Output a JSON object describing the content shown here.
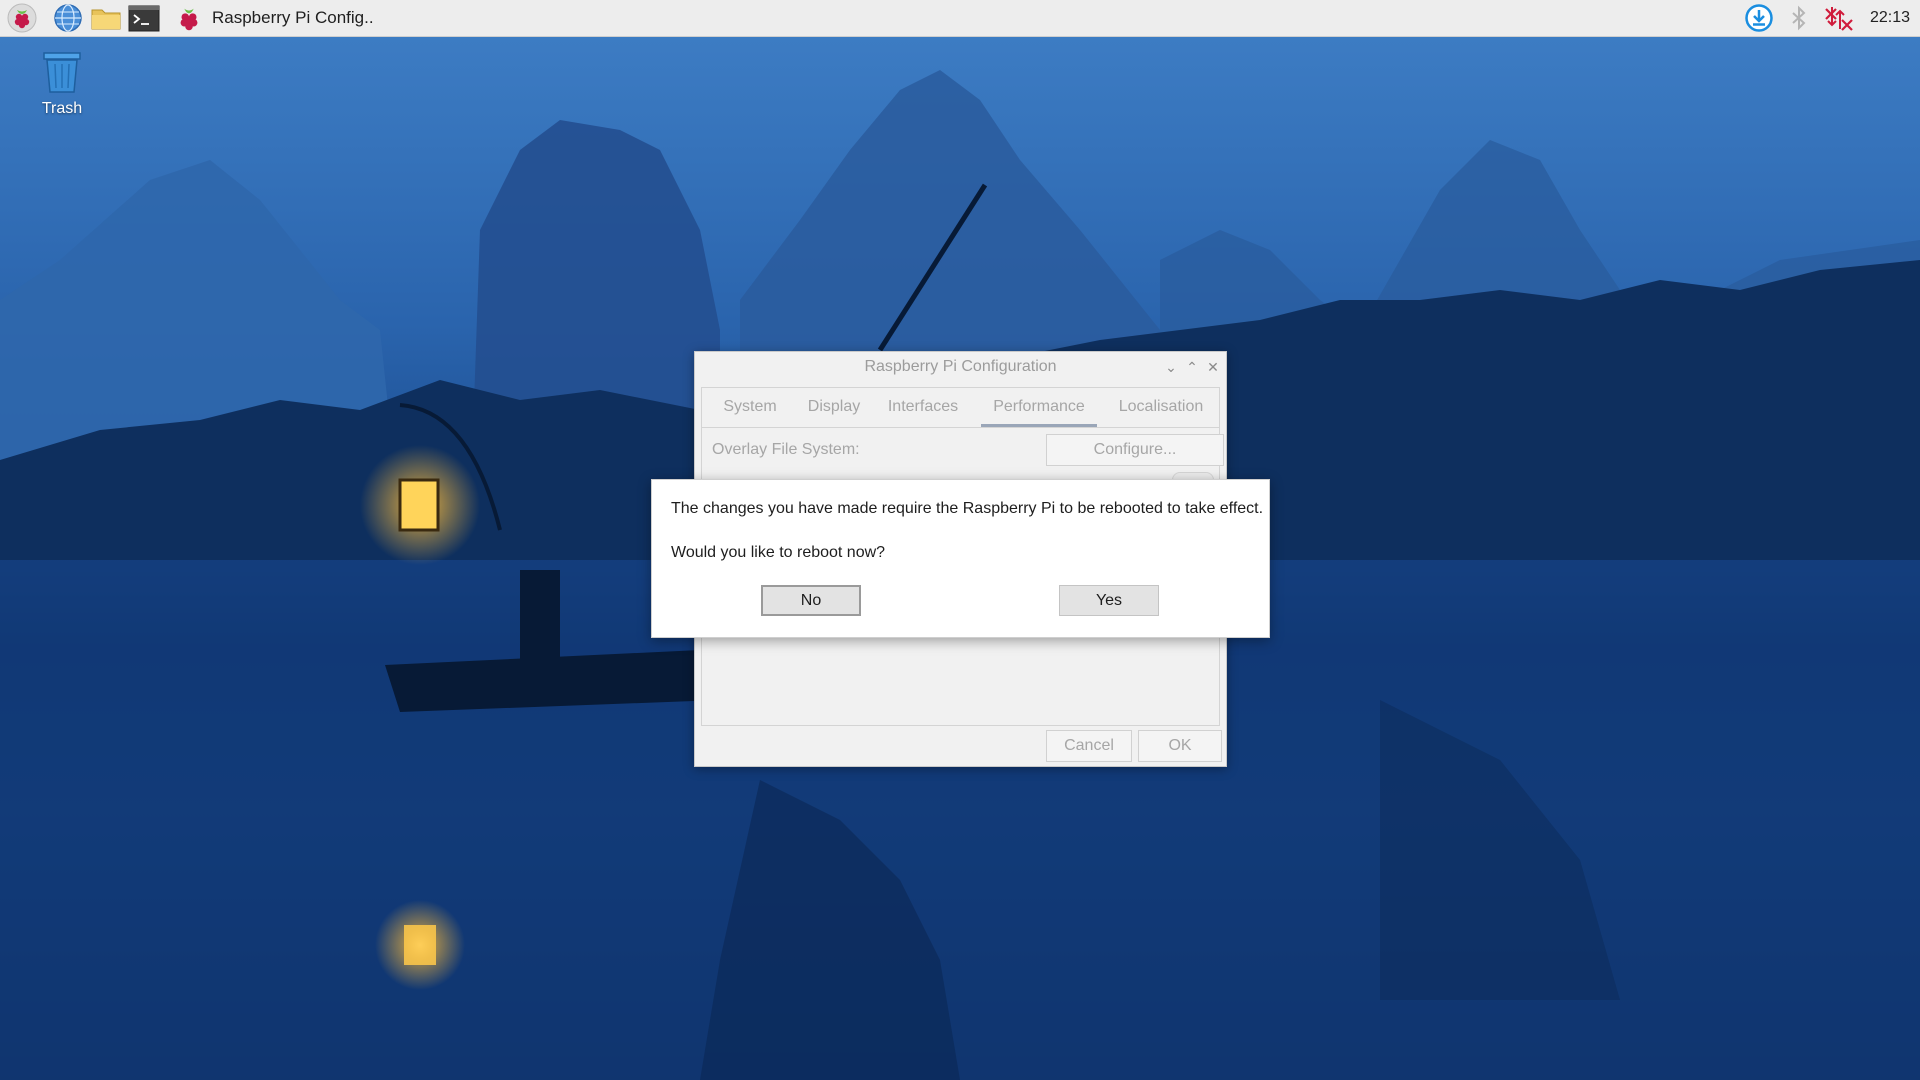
{
  "taskbar": {
    "launchers": [
      {
        "name": "raspberry-menu",
        "icon": "raspberry-icon"
      },
      {
        "name": "web-browser",
        "icon": "globe-icon"
      },
      {
        "name": "file-manager",
        "icon": "folder-icon"
      },
      {
        "name": "terminal",
        "icon": "terminal-icon"
      }
    ],
    "active_task": {
      "label": "Raspberry Pi Config..",
      "icon": "raspberry-icon"
    },
    "tray": [
      {
        "name": "updates",
        "icon": "download-icon"
      },
      {
        "name": "bluetooth",
        "icon": "bluetooth-icon"
      },
      {
        "name": "network",
        "icon": "network-disconnected-icon"
      }
    ],
    "clock": "22:13"
  },
  "desktop": {
    "icons": [
      {
        "label": "Trash",
        "icon": "trash-icon"
      }
    ]
  },
  "config_window": {
    "title": "Raspberry Pi Configuration",
    "tabs": [
      {
        "label": "System",
        "active": false
      },
      {
        "label": "Display",
        "active": false
      },
      {
        "label": "Interfaces",
        "active": false
      },
      {
        "label": "Performance",
        "active": true
      },
      {
        "label": "Localisation",
        "active": false
      }
    ],
    "overlay_label": "Overlay File System:",
    "configure_label": "Configure...",
    "cancel_label": "Cancel",
    "ok_label": "OK"
  },
  "reboot_dialog": {
    "message": "The changes you have made require the Raspberry Pi to be rebooted to take effect.",
    "question": "Would you like to reboot now?",
    "no_label": "No",
    "yes_label": "Yes"
  },
  "colors": {
    "accent": "#1a8ee0",
    "raspberry": "#c51a4a",
    "leaf": "#6cc04a",
    "wallpaper_sky": "#3f7fc6",
    "wallpaper_water": "#0f3672"
  }
}
